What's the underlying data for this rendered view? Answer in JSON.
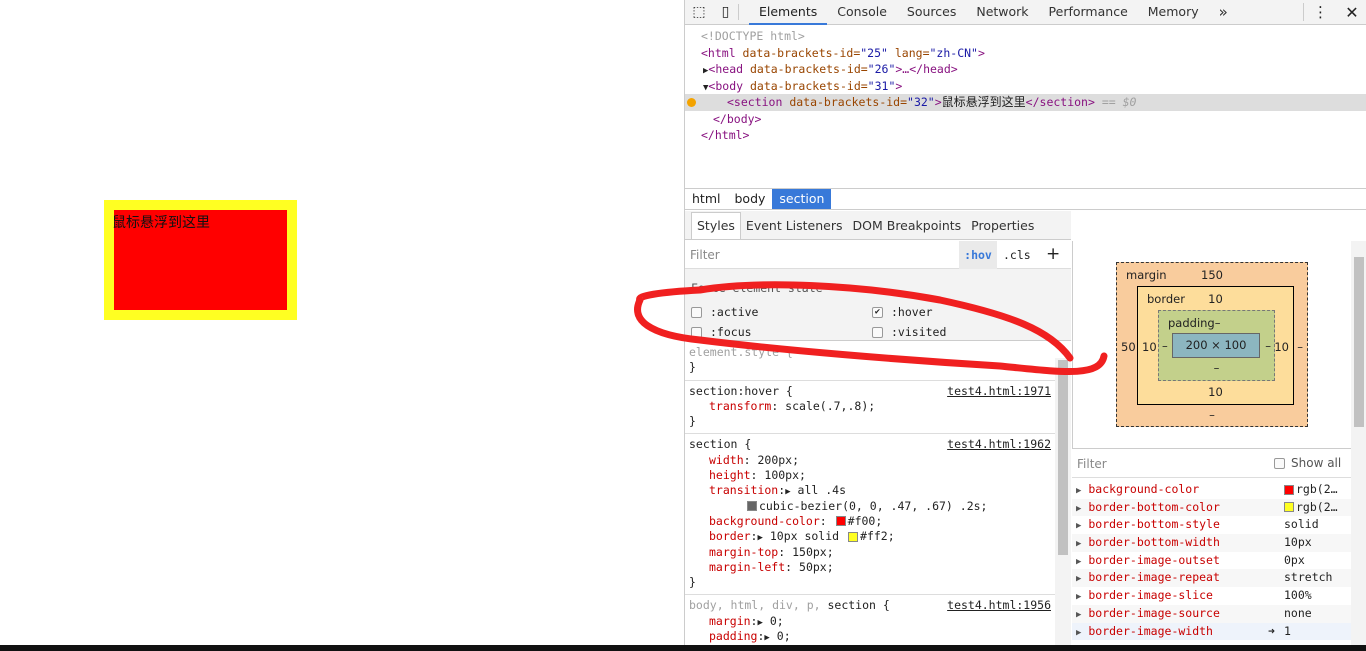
{
  "page": {
    "section_text": "鼠标悬浮到这里",
    "colors": {
      "background": "#ff0000",
      "border": "#ffff22"
    }
  },
  "devtools": {
    "tabs": [
      "Elements",
      "Console",
      "Sources",
      "Network",
      "Performance",
      "Memory"
    ],
    "active_tab": "Elements",
    "more_tabs": "»",
    "tree": {
      "doctype": "<!DOCTYPE html>",
      "html_open": [
        "<html",
        " data-brackets-id=",
        "\"25\"",
        " lang=",
        "\"zh-CN\"",
        ">"
      ],
      "head": [
        "<head",
        " data-brackets-id=",
        "\"26\"",
        ">…</head>"
      ],
      "body_open": [
        "<body",
        " data-brackets-id=",
        "\"31\"",
        ">"
      ],
      "section": [
        "<section",
        " data-brackets-id=",
        "\"32\"",
        ">",
        "鼠标悬浮到这里",
        "</section>",
        " == $0"
      ],
      "body_close": "</body>",
      "html_close": "</html>"
    },
    "breadcrumbs": [
      "html",
      "body",
      "section"
    ],
    "styles_tabs": [
      "Styles",
      "Event Listeners",
      "DOM Breakpoints",
      "Properties"
    ],
    "filter_placeholder": "Filter",
    "hov": ":hov",
    "cls": ".cls",
    "plus": "+",
    "force_title": "Force element state",
    "states": [
      {
        "label": ":active",
        "checked": false
      },
      {
        "label": ":hover",
        "checked": true
      },
      {
        "label": ":focus",
        "checked": false
      },
      {
        "label": ":visited",
        "checked": false
      }
    ],
    "rules": {
      "element_style": "element.style {",
      "close": "}",
      "hover_sel": "section:hover {",
      "hover_src": "test4.html:1971",
      "hover_prop": "transform",
      "hover_val": "scale(.7,.8);",
      "sec_sel": "section {",
      "sec_src": "test4.html:1962",
      "sec_props": [
        [
          "width",
          "200px;"
        ],
        [
          "height",
          "100px;"
        ]
      ],
      "transition_val": "all .4s",
      "transition_val2": "cubic-bezier(0, 0, .47, .67) .2s;",
      "bg_prop": "background-color",
      "bg_val": "#f00;",
      "border_prop": "border",
      "border_val": "10px solid",
      "border_color": "#ff2;",
      "margins": [
        [
          "margin-top",
          "150px;"
        ],
        [
          "margin-left",
          "50px;"
        ]
      ],
      "base_sel_gray": "body, html, div, p, ",
      "base_sel": "section {",
      "base_src": "test4.html:1956",
      "base_props": [
        [
          "margin",
          "0;"
        ],
        [
          "padding",
          "0;"
        ]
      ]
    },
    "box_model": {
      "margin_label": "margin",
      "margin_top": "150",
      "margin_left": "50",
      "margin_right": "–",
      "margin_bottom": "–",
      "border_label": "border",
      "border_top": "10",
      "border_left": "10",
      "border_right": "10",
      "border_bottom": "10",
      "padding_label": "padding",
      "padding_top": "–",
      "padding_left": "–",
      "padding_right": "–",
      "padding_bottom": "–",
      "content": "200 × 100"
    },
    "computed_filter": "Filter",
    "show_all": "Show all",
    "computed": [
      {
        "prop": "background-color",
        "val": "rgb(2…",
        "swatch": "#ff0000"
      },
      {
        "prop": "border-bottom-color",
        "val": "rgb(2…",
        "swatch": "#ffff22"
      },
      {
        "prop": "border-bottom-style",
        "val": "solid"
      },
      {
        "prop": "border-bottom-width",
        "val": "10px"
      },
      {
        "prop": "border-image-outset",
        "val": "0px"
      },
      {
        "prop": "border-image-repeat",
        "val": "stretch"
      },
      {
        "prop": "border-image-slice",
        "val": "100%"
      },
      {
        "prop": "border-image-source",
        "val": "none"
      },
      {
        "prop": "border-image-width",
        "val": "1"
      }
    ]
  }
}
